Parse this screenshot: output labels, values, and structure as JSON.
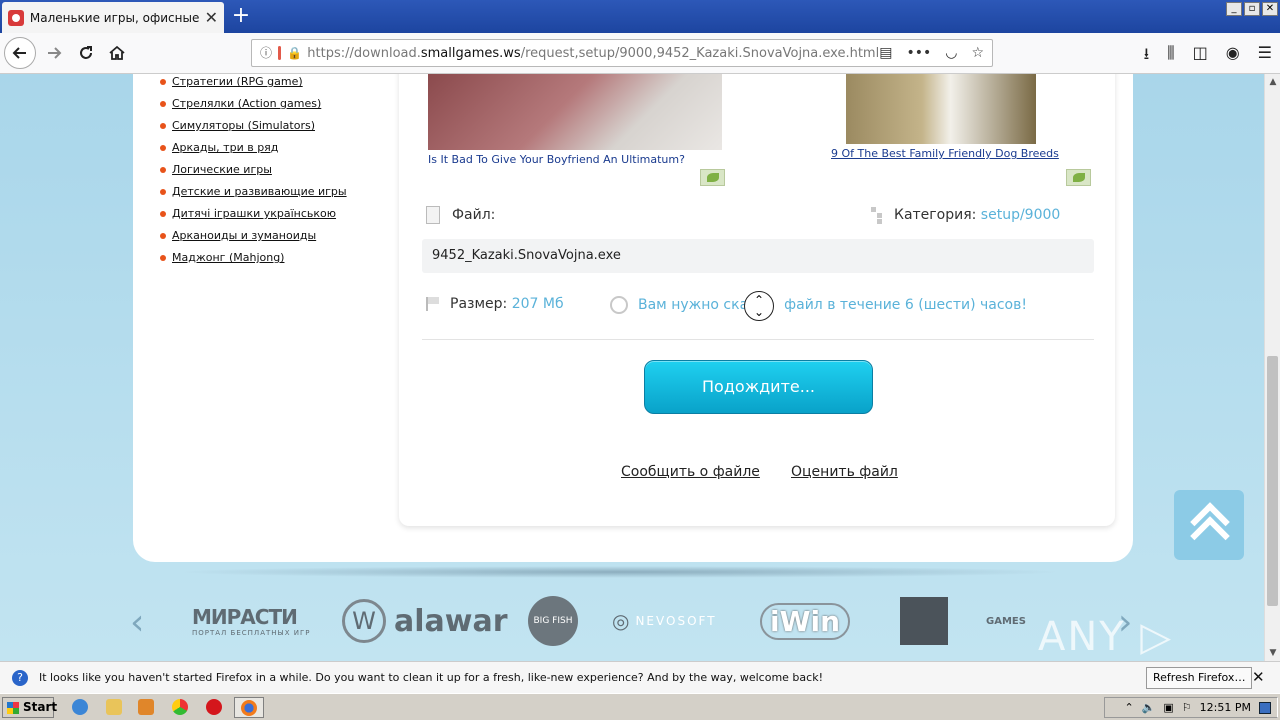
{
  "browser": {
    "tab_title": "Маленькие игры, офисные игры",
    "tab_close": "✕",
    "new_tab": "+",
    "window_controls": [
      "_",
      "▫",
      "✕"
    ],
    "url_prefix": "https://download.",
    "url_domain": "smallgames.ws",
    "url_path": "/request,setup/9000,9452_Kazaki.SnovaVojna.exe.html",
    "url_more": "•••"
  },
  "sidebar": {
    "categories": [
      "Стратегии (RPG game)",
      "Стрелялки (Action games)",
      "Симуляторы (Simulators)",
      "Аркады, три в ряд",
      "Логические игры",
      "Детские и развивающие игры",
      "Дитячі іграшки українською",
      "Арканоиды и зуманоиды",
      "Маджонг (Mahjong)"
    ]
  },
  "ads": [
    {
      "caption": "Is It Bad To Give Your Boyfriend An Ultimatum?"
    },
    {
      "caption": "9 Of The Best Family Friendly Dog Breeds"
    }
  ],
  "file": {
    "file_label": "Файл:",
    "category_label": "Категория:",
    "category_value": "setup/9000",
    "filename": "9452_Kazaki.SnovaVojna.exe",
    "size_label": "Размер:",
    "size_value": "207 Мб",
    "notice_before": "Вам нужно ска",
    "notice_after": " файл в течение 6 (шести) часов!",
    "wait_button": "Подождите...",
    "report_link": "Сообщить о файле",
    "rate_link": "Оценить файл"
  },
  "partners": {
    "prev": "‹",
    "next": "›",
    "logos": [
      "МИРАСТИ",
      "ПОРТАЛ БЕСПЛАТНЫХ ИГР",
      "alawar",
      "BIG FISH",
      "NEVOSOFT",
      "iWin",
      "GAMES"
    ]
  },
  "watermark": "ANY ▷ RUN",
  "notification": {
    "icon": "?",
    "text": "It looks like you haven't started Firefox in a while. Do you want to clean it up for a fresh, like-new experience? And by the way, welcome back!",
    "button": "Refresh Firefox…",
    "close": "✕"
  },
  "taskbar": {
    "start": "Start",
    "time": "12:51 PM"
  }
}
